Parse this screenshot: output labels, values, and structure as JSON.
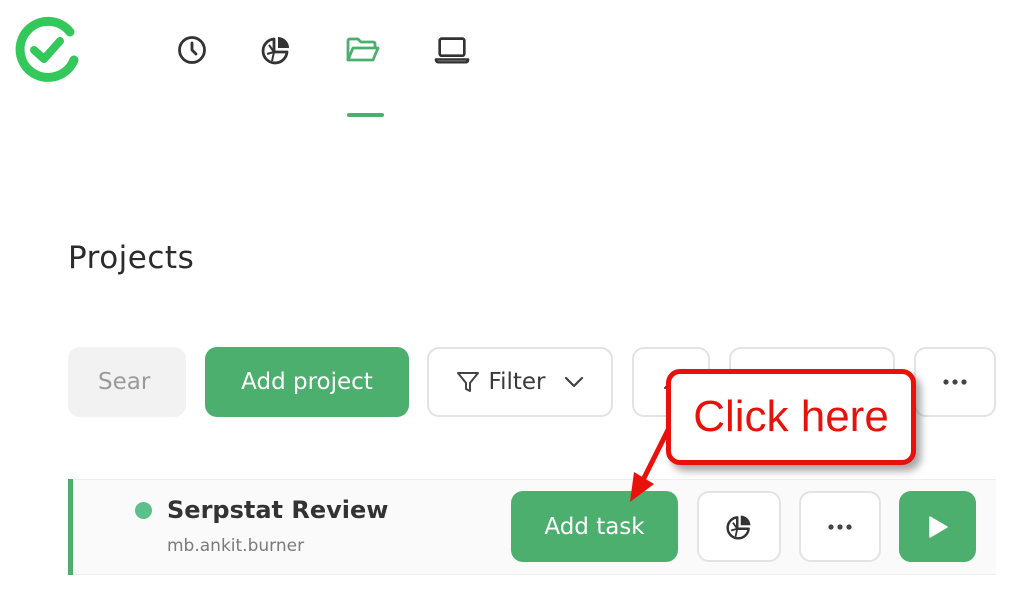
{
  "brand": {
    "logo_icon": "check-circle-logo-icon",
    "color": "#34c759"
  },
  "nav": {
    "active_index": 2,
    "items": [
      {
        "icon": "clock-icon"
      },
      {
        "icon": "pie-chart-icon"
      },
      {
        "icon": "folder-open-icon"
      },
      {
        "icon": "laptop-icon"
      }
    ]
  },
  "page": {
    "title": "Projects"
  },
  "toolbar": {
    "search_placeholder": "Sear",
    "add_project_label": "Add project",
    "filter_label": "Filter"
  },
  "project": {
    "name": "Serpstat Review",
    "owner": "mb.ankit.burner",
    "status_color": "#5cc08a",
    "add_task_label": "Add task"
  },
  "annotation": {
    "text": "Click here",
    "color": "#e8120b"
  },
  "colors": {
    "accent": "#4caf6d"
  }
}
